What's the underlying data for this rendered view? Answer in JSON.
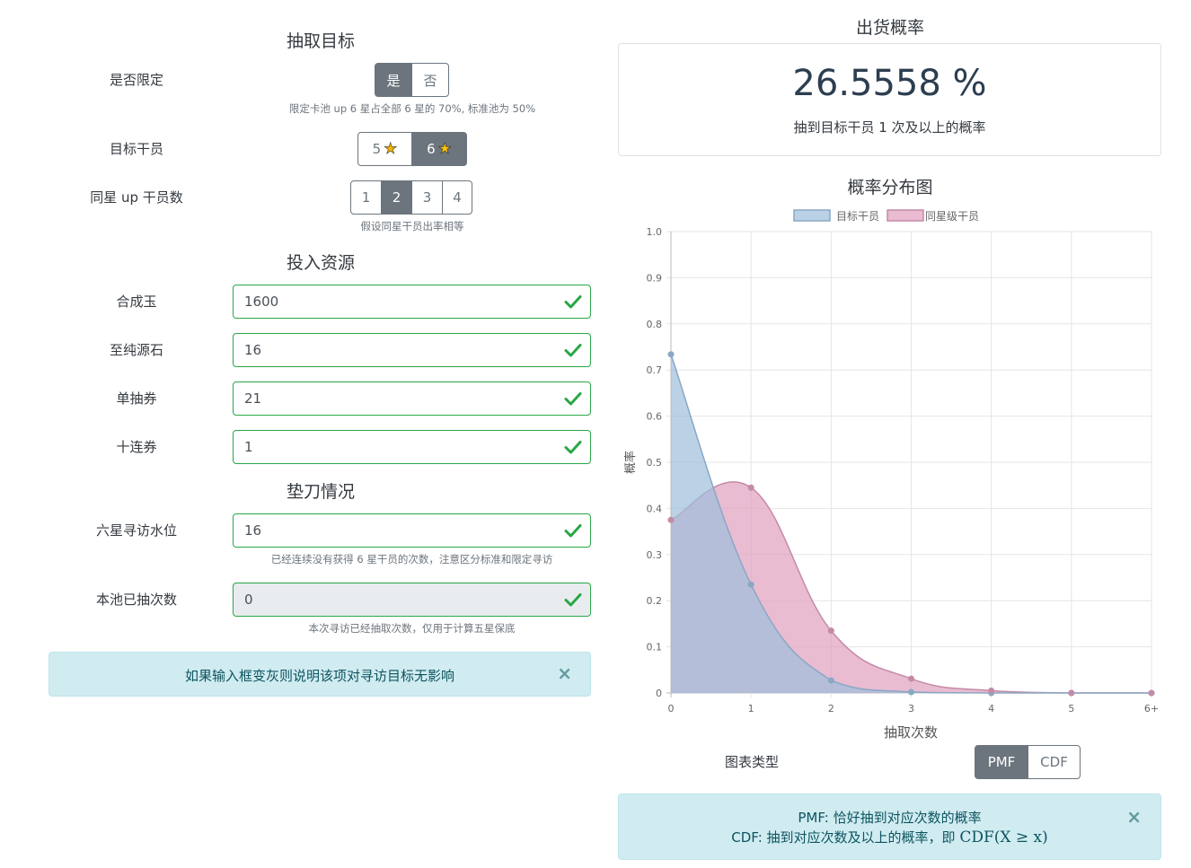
{
  "target": {
    "title": "抽取目标",
    "limited_label": "是否限定",
    "limited_options": [
      "是",
      "否"
    ],
    "limited_selected": 0,
    "limited_hint": "限定卡池 up 6 星占全部 6 星的 70%, 标准池为 50%",
    "operator_label": "目标干员",
    "operator_options": [
      "5",
      "6"
    ],
    "operator_selected": 1,
    "star_icon": "star-icon",
    "up_count_label": "同星 up 干员数",
    "up_count_options": [
      "1",
      "2",
      "3",
      "4"
    ],
    "up_count_selected": 1,
    "up_count_hint": "假设同星干员出率相等"
  },
  "resources": {
    "title": "投入资源",
    "orundum_label": "合成玉",
    "orundum_value": "1600",
    "originite_label": "至纯源石",
    "originite_value": "16",
    "single_ticket_label": "单抽券",
    "single_ticket_value": "21",
    "ten_ticket_label": "十连券",
    "ten_ticket_value": "1"
  },
  "pity": {
    "title": "垫刀情况",
    "six_star_pity_label": "六星寻访水位",
    "six_star_pity_value": "16",
    "six_star_pity_hint": "已经连续没有获得 6 星干员的次数，注意区分标准和限定寻访",
    "pool_pulls_label": "本池已抽次数",
    "pool_pulls_value": "0",
    "pool_pulls_hint": "本次寻访已经抽取次数，仅用于计算五星保底"
  },
  "left_alert": {
    "text": "如果输入框变灰则说明该项对寻访目标无影响",
    "close": "×"
  },
  "result": {
    "title": "出货概率",
    "value": "26.5558 %",
    "caption": "抽到目标干员 1 次及以上的概率"
  },
  "chart_section": {
    "title": "概率分布图",
    "type_label": "图表类型",
    "type_options": [
      "PMF",
      "CDF"
    ],
    "type_selected": 0
  },
  "right_alert": {
    "line1": "PMF: 恰好抽到对应次数的概率",
    "line2_prefix": "CDF: 抽到对应次数及以上的概率，即 ",
    "line2_formula": "CDF(X ≥ x)",
    "close": "×"
  },
  "colors": {
    "success": "#28a745",
    "secondary": "#6c757d",
    "alert_bg": "#d1ecf1",
    "series_target": "#9ebfdc",
    "series_same_star": "#dfa0bf"
  },
  "chart_data": {
    "type": "area",
    "categories": [
      "0",
      "1",
      "2",
      "3",
      "4",
      "5",
      "6+"
    ],
    "series": [
      {
        "name": "目标干员",
        "values": [
          0.734,
          0.235,
          0.027,
          0.002,
          0.0,
          0.0,
          0.0
        ],
        "color": "#9ebfdc",
        "stroke": "#8aa7c4"
      },
      {
        "name": "同星级干员",
        "values": [
          0.375,
          0.445,
          0.135,
          0.031,
          0.005,
          0.0,
          0.0
        ],
        "color": "#dfa0bf",
        "stroke": "#c48aa6"
      }
    ],
    "ylabel": "概率",
    "xlabel": "抽取次数",
    "yticks": [
      "0",
      "0.1",
      "0.2",
      "0.3",
      "0.4",
      "0.5",
      "0.6",
      "0.7",
      "0.8",
      "0.9",
      "1.0"
    ],
    "ylim": [
      0,
      1
    ],
    "grid": true,
    "legend_position": "top"
  }
}
